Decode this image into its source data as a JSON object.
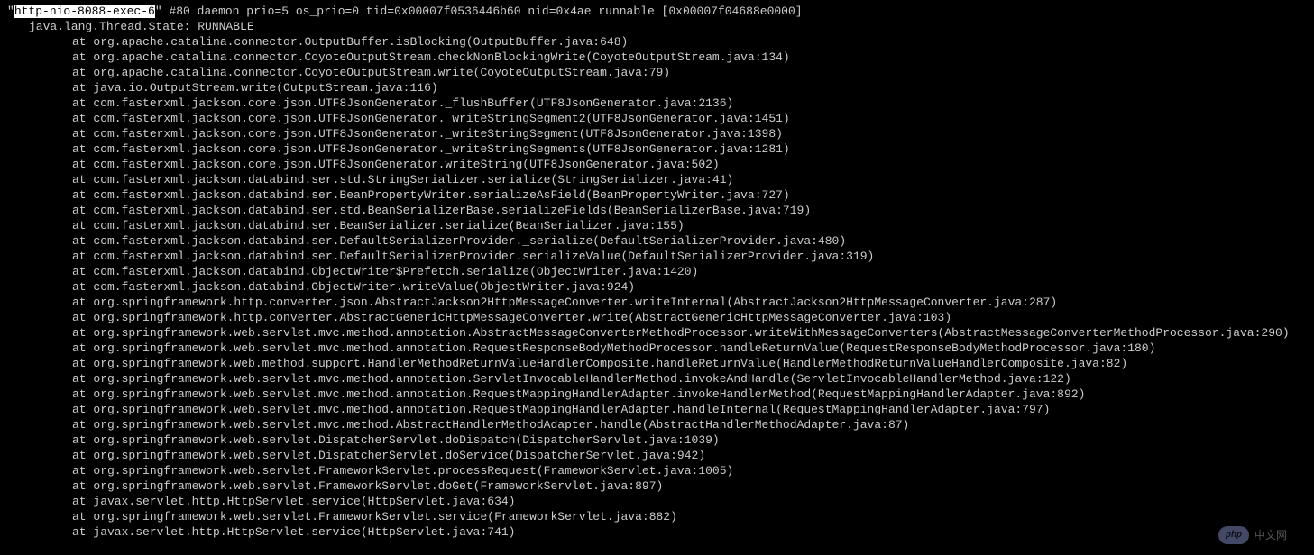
{
  "thread": {
    "name_quoted_prefix": "\"",
    "name_highlighted": "http-nio-8088-exec-6",
    "name_quoted_suffix": "\"",
    "header_rest": " #80 daemon prio=5 os_prio=0 tid=0x00007f0536446b60 nid=0x4ae runnable [0x00007f04688e0000]",
    "state_line": "java.lang.Thread.State: RUNNABLE"
  },
  "stack": [
    "at org.apache.catalina.connector.OutputBuffer.isBlocking(OutputBuffer.java:648)",
    "at org.apache.catalina.connector.CoyoteOutputStream.checkNonBlockingWrite(CoyoteOutputStream.java:134)",
    "at org.apache.catalina.connector.CoyoteOutputStream.write(CoyoteOutputStream.java:79)",
    "at java.io.OutputStream.write(OutputStream.java:116)",
    "at com.fasterxml.jackson.core.json.UTF8JsonGenerator._flushBuffer(UTF8JsonGenerator.java:2136)",
    "at com.fasterxml.jackson.core.json.UTF8JsonGenerator._writeStringSegment2(UTF8JsonGenerator.java:1451)",
    "at com.fasterxml.jackson.core.json.UTF8JsonGenerator._writeStringSegment(UTF8JsonGenerator.java:1398)",
    "at com.fasterxml.jackson.core.json.UTF8JsonGenerator._writeStringSegments(UTF8JsonGenerator.java:1281)",
    "at com.fasterxml.jackson.core.json.UTF8JsonGenerator.writeString(UTF8JsonGenerator.java:502)",
    "at com.fasterxml.jackson.databind.ser.std.StringSerializer.serialize(StringSerializer.java:41)",
    "at com.fasterxml.jackson.databind.ser.BeanPropertyWriter.serializeAsField(BeanPropertyWriter.java:727)",
    "at com.fasterxml.jackson.databind.ser.std.BeanSerializerBase.serializeFields(BeanSerializerBase.java:719)",
    "at com.fasterxml.jackson.databind.ser.BeanSerializer.serialize(BeanSerializer.java:155)",
    "at com.fasterxml.jackson.databind.ser.DefaultSerializerProvider._serialize(DefaultSerializerProvider.java:480)",
    "at com.fasterxml.jackson.databind.ser.DefaultSerializerProvider.serializeValue(DefaultSerializerProvider.java:319)",
    "at com.fasterxml.jackson.databind.ObjectWriter$Prefetch.serialize(ObjectWriter.java:1420)",
    "at com.fasterxml.jackson.databind.ObjectWriter.writeValue(ObjectWriter.java:924)",
    "at org.springframework.http.converter.json.AbstractJackson2HttpMessageConverter.writeInternal(AbstractJackson2HttpMessageConverter.java:287)",
    "at org.springframework.http.converter.AbstractGenericHttpMessageConverter.write(AbstractGenericHttpMessageConverter.java:103)",
    "at org.springframework.web.servlet.mvc.method.annotation.AbstractMessageConverterMethodProcessor.writeWithMessageConverters(AbstractMessageConverterMethodProcessor.java:290)",
    "at org.springframework.web.servlet.mvc.method.annotation.RequestResponseBodyMethodProcessor.handleReturnValue(RequestResponseBodyMethodProcessor.java:180)",
    "at org.springframework.web.method.support.HandlerMethodReturnValueHandlerComposite.handleReturnValue(HandlerMethodReturnValueHandlerComposite.java:82)",
    "at org.springframework.web.servlet.mvc.method.annotation.ServletInvocableHandlerMethod.invokeAndHandle(ServletInvocableHandlerMethod.java:122)",
    "at org.springframework.web.servlet.mvc.method.annotation.RequestMappingHandlerAdapter.invokeHandlerMethod(RequestMappingHandlerAdapter.java:892)",
    "at org.springframework.web.servlet.mvc.method.annotation.RequestMappingHandlerAdapter.handleInternal(RequestMappingHandlerAdapter.java:797)",
    "at org.springframework.web.servlet.mvc.method.AbstractHandlerMethodAdapter.handle(AbstractHandlerMethodAdapter.java:87)",
    "at org.springframework.web.servlet.DispatcherServlet.doDispatch(DispatcherServlet.java:1039)",
    "at org.springframework.web.servlet.DispatcherServlet.doService(DispatcherServlet.java:942)",
    "at org.springframework.web.servlet.FrameworkServlet.processRequest(FrameworkServlet.java:1005)",
    "at org.springframework.web.servlet.FrameworkServlet.doGet(FrameworkServlet.java:897)",
    "at javax.servlet.http.HttpServlet.service(HttpServlet.java:634)",
    "at org.springframework.web.servlet.FrameworkServlet.service(FrameworkServlet.java:882)",
    "at javax.servlet.http.HttpServlet.service(HttpServlet.java:741)"
  ],
  "watermark": {
    "logo_text": "php",
    "site_text": "中文网"
  }
}
